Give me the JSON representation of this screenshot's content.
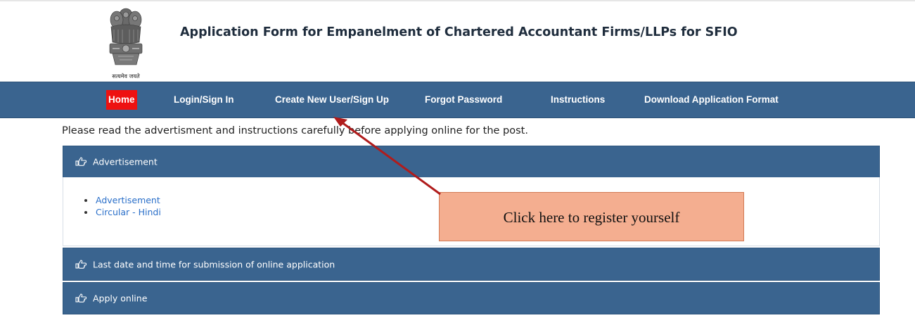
{
  "header": {
    "emblem_caption": "सत्यमेव जयते",
    "title": "Application Form for Empanelment of Chartered Accountant Firms/LLPs for SFIO"
  },
  "nav": {
    "items": [
      {
        "label": "Home",
        "active": true
      },
      {
        "label": "Login/Sign In"
      },
      {
        "label": "Create New User/Sign Up"
      },
      {
        "label": "Forgot Password"
      },
      {
        "label": "Instructions"
      },
      {
        "label": "Download Application Format"
      }
    ]
  },
  "intro_text": "Please read the advertisment and instructions carefully before applying online for the post.",
  "panels": [
    {
      "title": "Advertisement",
      "icon": "hand-point-right-icon",
      "links": [
        "Advertisement",
        "Circular - Hindi"
      ]
    },
    {
      "title": "Last date and time for submission of online application",
      "icon": "hand-point-right-icon"
    },
    {
      "title": "Apply online",
      "icon": "hand-point-right-icon"
    }
  ],
  "annotation": {
    "callout_text": "Click here to register yourself",
    "arrow_color": "#b01c1c"
  },
  "colors": {
    "navbar": "#3a648f",
    "active_nav": "#ee1111",
    "link": "#2a6fc9",
    "callout_fill": "#f4ae90"
  }
}
